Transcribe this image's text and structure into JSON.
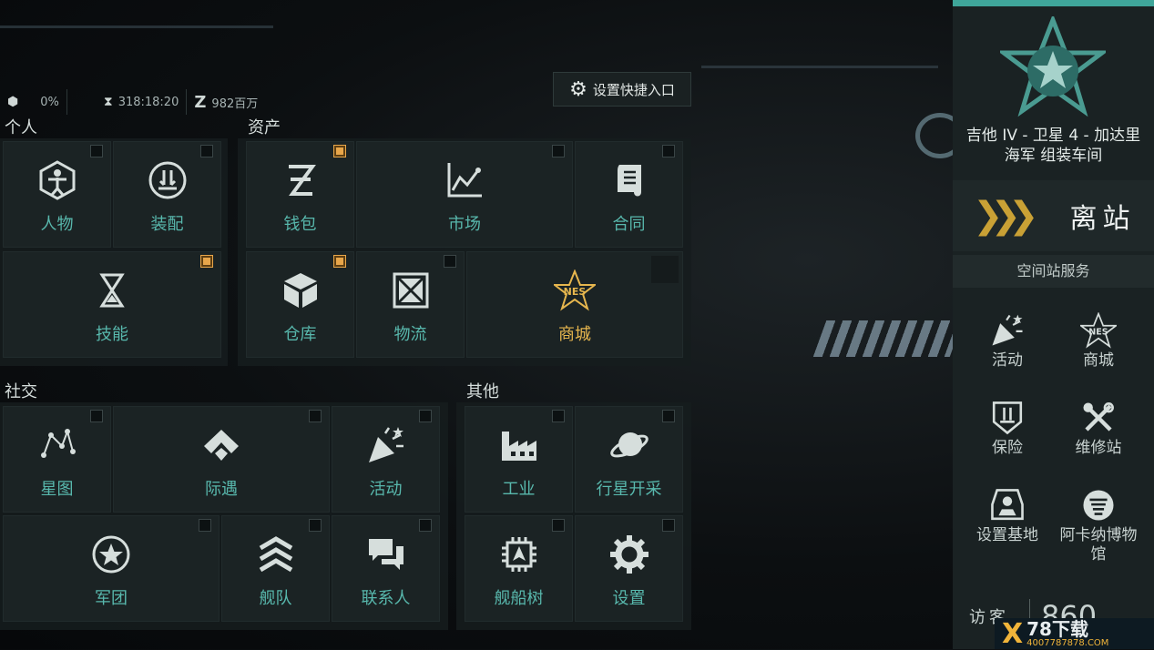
{
  "topbar": {
    "cargo": "0%",
    "skill_time": "318:18:20",
    "isk": "982百万",
    "quick_entry": "设置快捷入口"
  },
  "sections": {
    "personal": "个人",
    "assets": "资产",
    "social": "社交",
    "other": "其他"
  },
  "personal": [
    {
      "label": "人物",
      "checked": false
    },
    {
      "label": "装配",
      "checked": false
    },
    {
      "label": "技能",
      "checked": true
    }
  ],
  "assets": [
    {
      "label": "钱包",
      "checked": true
    },
    {
      "label": "市场",
      "checked": false
    },
    {
      "label": "合同",
      "checked": false
    },
    {
      "label": "仓库",
      "checked": true
    },
    {
      "label": "物流",
      "checked": false
    },
    {
      "label": "商城",
      "checked": false
    }
  ],
  "social": [
    {
      "label": "星图",
      "checked": false
    },
    {
      "label": "际遇",
      "checked": false
    },
    {
      "label": "活动",
      "checked": false
    },
    {
      "label": "军团",
      "checked": false
    },
    {
      "label": "舰队",
      "checked": false
    },
    {
      "label": "联系人",
      "checked": false
    }
  ],
  "other": [
    {
      "label": "工业",
      "checked": false
    },
    {
      "label": "行星开采",
      "checked": false
    },
    {
      "label": "舰船树",
      "checked": false
    },
    {
      "label": "设置",
      "checked": false
    }
  ],
  "station": {
    "location_line1": "吉他 IV - 卫星 4 - 加达里",
    "location_line2": "海军 组装车间",
    "undock": "离站",
    "services_title": "空间站服务",
    "services": [
      "活动",
      "商城",
      "保险",
      "维修站",
      "设置基地",
      "阿卡纳博物馆"
    ],
    "visitor_label": "访客",
    "visitor_count": "860"
  },
  "watermark": {
    "x": "X",
    "name": "78下载",
    "url": "4007787878.COM"
  },
  "colors": {
    "accent_teal": "#58b8ad",
    "accent_gold": "#e6b64e",
    "check_on": "#e8a64a"
  }
}
